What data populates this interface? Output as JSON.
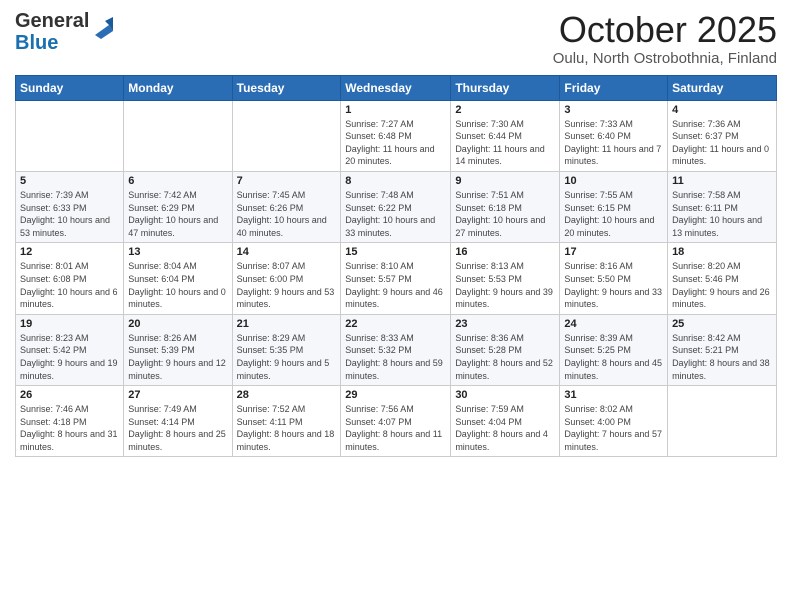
{
  "header": {
    "logo_general": "General",
    "logo_blue": "Blue",
    "month_year": "October 2025",
    "location": "Oulu, North Ostrobothnia, Finland"
  },
  "weekdays": [
    "Sunday",
    "Monday",
    "Tuesday",
    "Wednesday",
    "Thursday",
    "Friday",
    "Saturday"
  ],
  "weeks": [
    [
      {
        "day": "",
        "sunrise": "",
        "sunset": "",
        "daylight": ""
      },
      {
        "day": "",
        "sunrise": "",
        "sunset": "",
        "daylight": ""
      },
      {
        "day": "",
        "sunrise": "",
        "sunset": "",
        "daylight": ""
      },
      {
        "day": "1",
        "sunrise": "7:27 AM",
        "sunset": "6:48 PM",
        "daylight": "11 hours and 20 minutes."
      },
      {
        "day": "2",
        "sunrise": "7:30 AM",
        "sunset": "6:44 PM",
        "daylight": "11 hours and 14 minutes."
      },
      {
        "day": "3",
        "sunrise": "7:33 AM",
        "sunset": "6:40 PM",
        "daylight": "11 hours and 7 minutes."
      },
      {
        "day": "4",
        "sunrise": "7:36 AM",
        "sunset": "6:37 PM",
        "daylight": "11 hours and 0 minutes."
      }
    ],
    [
      {
        "day": "5",
        "sunrise": "7:39 AM",
        "sunset": "6:33 PM",
        "daylight": "10 hours and 53 minutes."
      },
      {
        "day": "6",
        "sunrise": "7:42 AM",
        "sunset": "6:29 PM",
        "daylight": "10 hours and 47 minutes."
      },
      {
        "day": "7",
        "sunrise": "7:45 AM",
        "sunset": "6:26 PM",
        "daylight": "10 hours and 40 minutes."
      },
      {
        "day": "8",
        "sunrise": "7:48 AM",
        "sunset": "6:22 PM",
        "daylight": "10 hours and 33 minutes."
      },
      {
        "day": "9",
        "sunrise": "7:51 AM",
        "sunset": "6:18 PM",
        "daylight": "10 hours and 27 minutes."
      },
      {
        "day": "10",
        "sunrise": "7:55 AM",
        "sunset": "6:15 PM",
        "daylight": "10 hours and 20 minutes."
      },
      {
        "day": "11",
        "sunrise": "7:58 AM",
        "sunset": "6:11 PM",
        "daylight": "10 hours and 13 minutes."
      }
    ],
    [
      {
        "day": "12",
        "sunrise": "8:01 AM",
        "sunset": "6:08 PM",
        "daylight": "10 hours and 6 minutes."
      },
      {
        "day": "13",
        "sunrise": "8:04 AM",
        "sunset": "6:04 PM",
        "daylight": "10 hours and 0 minutes."
      },
      {
        "day": "14",
        "sunrise": "8:07 AM",
        "sunset": "6:00 PM",
        "daylight": "9 hours and 53 minutes."
      },
      {
        "day": "15",
        "sunrise": "8:10 AM",
        "sunset": "5:57 PM",
        "daylight": "9 hours and 46 minutes."
      },
      {
        "day": "16",
        "sunrise": "8:13 AM",
        "sunset": "5:53 PM",
        "daylight": "9 hours and 39 minutes."
      },
      {
        "day": "17",
        "sunrise": "8:16 AM",
        "sunset": "5:50 PM",
        "daylight": "9 hours and 33 minutes."
      },
      {
        "day": "18",
        "sunrise": "8:20 AM",
        "sunset": "5:46 PM",
        "daylight": "9 hours and 26 minutes."
      }
    ],
    [
      {
        "day": "19",
        "sunrise": "8:23 AM",
        "sunset": "5:42 PM",
        "daylight": "9 hours and 19 minutes."
      },
      {
        "day": "20",
        "sunrise": "8:26 AM",
        "sunset": "5:39 PM",
        "daylight": "9 hours and 12 minutes."
      },
      {
        "day": "21",
        "sunrise": "8:29 AM",
        "sunset": "5:35 PM",
        "daylight": "9 hours and 5 minutes."
      },
      {
        "day": "22",
        "sunrise": "8:33 AM",
        "sunset": "5:32 PM",
        "daylight": "8 hours and 59 minutes."
      },
      {
        "day": "23",
        "sunrise": "8:36 AM",
        "sunset": "5:28 PM",
        "daylight": "8 hours and 52 minutes."
      },
      {
        "day": "24",
        "sunrise": "8:39 AM",
        "sunset": "5:25 PM",
        "daylight": "8 hours and 45 minutes."
      },
      {
        "day": "25",
        "sunrise": "8:42 AM",
        "sunset": "5:21 PM",
        "daylight": "8 hours and 38 minutes."
      }
    ],
    [
      {
        "day": "26",
        "sunrise": "7:46 AM",
        "sunset": "4:18 PM",
        "daylight": "8 hours and 31 minutes."
      },
      {
        "day": "27",
        "sunrise": "7:49 AM",
        "sunset": "4:14 PM",
        "daylight": "8 hours and 25 minutes."
      },
      {
        "day": "28",
        "sunrise": "7:52 AM",
        "sunset": "4:11 PM",
        "daylight": "8 hours and 18 minutes."
      },
      {
        "day": "29",
        "sunrise": "7:56 AM",
        "sunset": "4:07 PM",
        "daylight": "8 hours and 11 minutes."
      },
      {
        "day": "30",
        "sunrise": "7:59 AM",
        "sunset": "4:04 PM",
        "daylight": "8 hours and 4 minutes."
      },
      {
        "day": "31",
        "sunrise": "8:02 AM",
        "sunset": "4:00 PM",
        "daylight": "7 hours and 57 minutes."
      },
      {
        "day": "",
        "sunrise": "",
        "sunset": "",
        "daylight": ""
      }
    ]
  ]
}
